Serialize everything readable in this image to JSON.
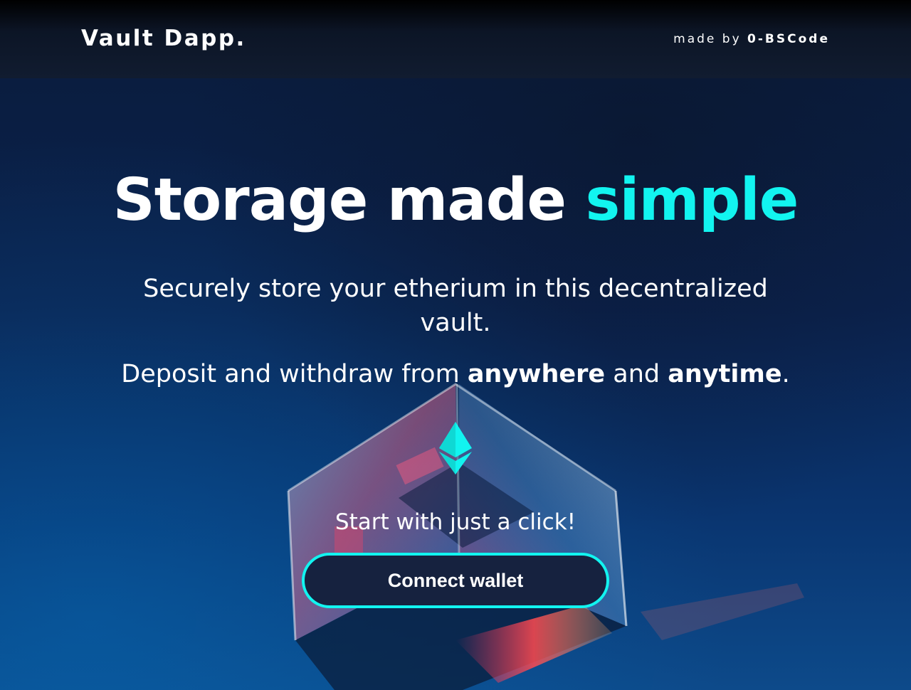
{
  "header": {
    "brand": "Vault Dapp.",
    "credit_prefix": "made by",
    "credit_author": "0-BSCode"
  },
  "hero": {
    "title_main": "Storage made ",
    "title_accent": "simple",
    "subtitle": "Securely store your etherium in this decentralized vault.",
    "line2_prefix": "Deposit and withdraw from ",
    "line2_bold1": "anywhere",
    "line2_mid": " and ",
    "line2_bold2": "anytime",
    "line2_suffix": ".",
    "cta_text": "Start with just a click!",
    "button_label": "Connect wallet"
  },
  "icons": {
    "ethereum": "ethereum-icon"
  },
  "colors": {
    "accent": "#12f4f0",
    "button_bg": "#16223f",
    "header_bg": "#111c30",
    "page_bg": "#0b2350"
  }
}
